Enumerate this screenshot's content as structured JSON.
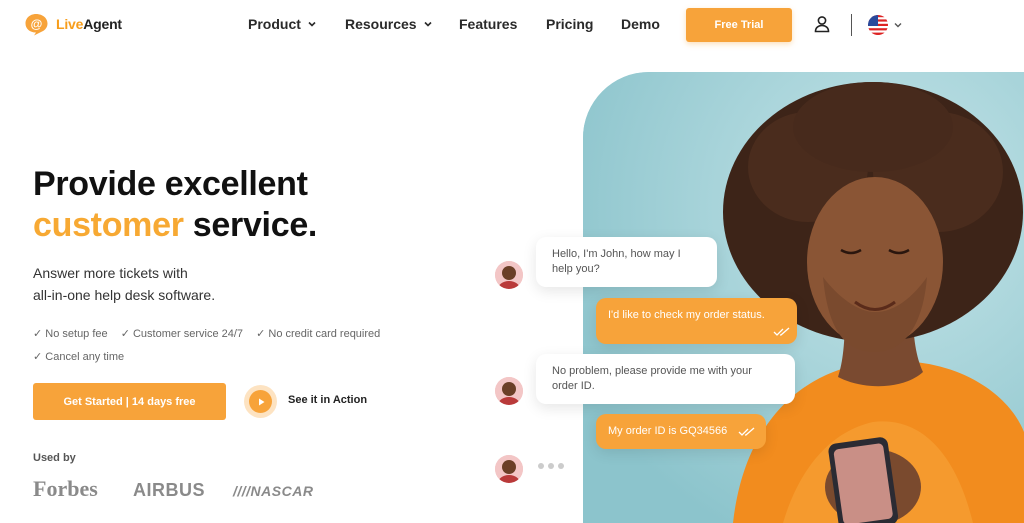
{
  "brand": {
    "name_left": "Live",
    "name_right": "Agent",
    "accent_color": "#f7a33a"
  },
  "nav": {
    "items": [
      {
        "label": "Product",
        "has_menu": true
      },
      {
        "label": "Resources",
        "has_menu": true
      },
      {
        "label": "Features",
        "has_menu": false
      },
      {
        "label": "Pricing",
        "has_menu": false
      },
      {
        "label": "Demo",
        "has_menu": false
      }
    ],
    "trial_label": "Free Trial",
    "user_icon": "user-icon",
    "language_icon": "us-flag-icon"
  },
  "hero": {
    "title_line1": "Provide excellent",
    "title_accent": "customer",
    "title_rest": " service.",
    "subtitle_line1": "Answer more tickets with",
    "subtitle_line2": "all-in-one help desk software.",
    "features": [
      "✓ No setup fee",
      "✓ Customer service 24/7",
      "✓ No credit card required",
      "✓ Cancel any time"
    ],
    "cta_label": "Get Started | 14 days free",
    "video_label": "See it in Action",
    "used_by_label": "Used by",
    "logos": [
      "Forbes",
      "AIRBUS",
      "////NASCAR"
    ]
  },
  "chat": {
    "messages": [
      {
        "from": "agent",
        "text": "Hello, I'm John, how may I help you?"
      },
      {
        "from": "customer",
        "text": "I'd like to check my order status."
      },
      {
        "from": "agent",
        "text": "No problem, please provide me with your order ID."
      },
      {
        "from": "customer",
        "text": "My order ID is GQ34566"
      }
    ]
  }
}
